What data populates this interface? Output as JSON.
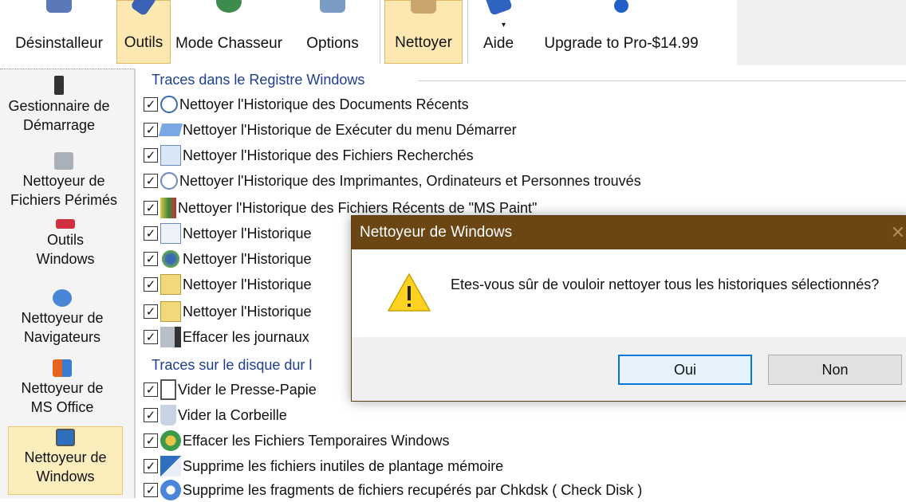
{
  "toolbar": {
    "items": [
      {
        "label": "Désinstalleur",
        "active": false
      },
      {
        "label": "Outils",
        "active": true
      },
      {
        "label": "Mode Chasseur",
        "active": false
      },
      {
        "label": "Options",
        "active": false
      },
      {
        "label": "Nettoyer",
        "active": true
      },
      {
        "label": "Aide",
        "active": false
      },
      {
        "label": "Upgrade to Pro-$14.99",
        "active": false
      }
    ],
    "accent_active": "#fce8b0"
  },
  "sidebar": {
    "items": [
      {
        "label": "Gestionnaire de Démarrage",
        "line1": "Gestionnaire de",
        "line2": "Démarrage",
        "icon": "traffic-light-icon"
      },
      {
        "label": "Nettoyeur de Fichiers Périmés",
        "line1": "Nettoyeur de",
        "line2": "Fichiers Périmés",
        "icon": "file-cleaner-icon"
      },
      {
        "label": "Outils Windows",
        "line1": "Outils",
        "line2": "Windows",
        "icon": "windows-tools-icon"
      },
      {
        "label": "Nettoyeur de Navigateurs",
        "line1": "Nettoyeur de",
        "line2": "Navigateurs",
        "icon": "browser-globe-icon"
      },
      {
        "label": "Nettoyeur de MS Office",
        "line1": "Nettoyeur de",
        "line2": "MS Office",
        "icon": "ms-office-icon"
      },
      {
        "label": "Nettoyeur de Windows",
        "line1": "Nettoyeur de",
        "line2": "Windows",
        "icon": "windows-monitor-icon",
        "active": true
      }
    ]
  },
  "main": {
    "section_registry": "Traces dans le Registre Windows",
    "section_disk": "Traces sur le disque dur l",
    "registry_rows": [
      {
        "label": "Nettoyer l'Historique des Documents Récents",
        "icon": "clock-document-icon",
        "checked": true
      },
      {
        "label": "Nettoyer l'Historique de Exécuter du menu Démarrer",
        "icon": "run-window-icon",
        "checked": true
      },
      {
        "label": "Nettoyer l'Historique des Fichiers Recherchés",
        "icon": "search-files-icon",
        "checked": true
      },
      {
        "label": "Nettoyer l'Historique des Imprimantes, Ordinateurs et Personnes trouvés",
        "icon": "magnifier-icon",
        "checked": true
      },
      {
        "label": "Nettoyer l'Historique des Fichiers Récents de \"MS Paint\"",
        "icon": "paint-icon",
        "checked": true
      },
      {
        "label": "Nettoyer l'Historique",
        "icon": "wordpad-icon",
        "checked": true
      },
      {
        "label": "Nettoyer l'Historique",
        "icon": "network-icon",
        "checked": true
      },
      {
        "label": "Nettoyer l'Historique",
        "icon": "calc-folder-icon",
        "checked": true
      },
      {
        "label": "Nettoyer l'Historique",
        "icon": "calc-folder-icon",
        "checked": true
      },
      {
        "label": "Effacer les journaux",
        "icon": "event-log-icon",
        "checked": true
      }
    ],
    "disk_rows": [
      {
        "label": "Vider le Presse-Papie",
        "icon": "clipboard-icon",
        "checked": true
      },
      {
        "label": "Vider la Corbeille",
        "icon": "recycle-bin-icon",
        "checked": true
      },
      {
        "label": "Effacer les Fichiers Temporaires Windows",
        "icon": "temp-files-icon",
        "checked": true
      },
      {
        "label": "Supprime les fichiers inutiles de plantage mémoire",
        "icon": "memory-dump-icon",
        "checked": true
      },
      {
        "label": "Supprime les fragments de fichiers recupérés par Chkdsk ( Check Disk )",
        "icon": "chkdsk-icon",
        "checked": true
      }
    ]
  },
  "dialog": {
    "title": "Nettoyeur de Windows",
    "close": "✕",
    "message": "Etes-vous sûr de vouloir nettoyer tous les historiques sélectionnés?",
    "icon": "warning-icon",
    "yes": "Oui",
    "no": "Non",
    "title_color": "#6b4513"
  }
}
